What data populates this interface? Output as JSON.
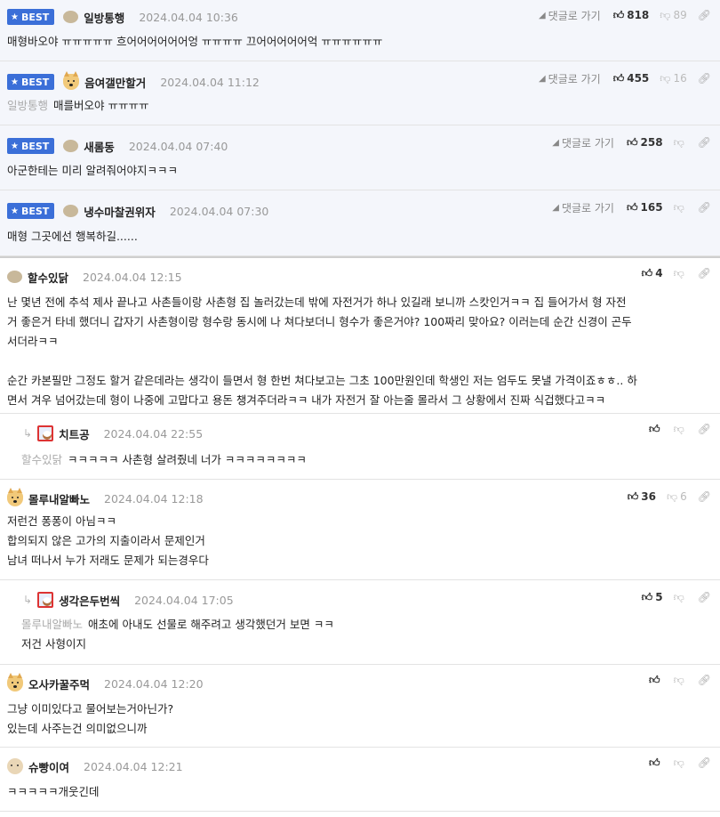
{
  "comments": [
    {
      "nick": "일방통행",
      "date": "2024.04.04 10:36",
      "best_label": "BEST",
      "goto_label": "댓글로 가기",
      "up": "818",
      "down": "89",
      "body": [
        "매형바오야 ㅠㅠㅠㅠㅠ 흐어어어어어어엉 ㅠㅠㅠㅠ 끄어어어어어억 ㅠㅠㅠㅠㅠㅠ"
      ]
    },
    {
      "nick": "음여갤만할거",
      "date": "2024.04.04 11:12",
      "best_label": "BEST",
      "goto_label": "댓글로 가기",
      "up": "455",
      "down": "16",
      "mention": "일방통행",
      "body": [
        "매를버오야 ㅠㅠㅠㅠ"
      ]
    },
    {
      "nick": "새롬동",
      "date": "2024.04.04 07:40",
      "best_label": "BEST",
      "goto_label": "댓글로 가기",
      "up": "258",
      "down": "",
      "body": [
        "아군한테는 미리 알려줘어야지ㅋㅋㅋ"
      ]
    },
    {
      "nick": "냉수마찰권위자",
      "date": "2024.04.04 07:30",
      "best_label": "BEST",
      "goto_label": "댓글로 가기",
      "up": "165",
      "down": "",
      "body": [
        "매형 그곳에선 행복하길......"
      ]
    },
    {
      "nick": "할수있닭",
      "date": "2024.04.04 12:15",
      "up": "4",
      "down": "",
      "body": [
        "난 몇년 전에 추석 제사 끝나고 사촌들이랑 사촌형 집 놀러갔는데 밖에 자전거가 하나 있길래 보니까 스캇인거ㅋㅋ 집 들어가서 형 자전",
        "거 좋은거 타네 했더니 갑자기 사촌형이랑 형수랑 동시에 나 쳐다보더니 형수가 좋은거야? 100짜리 맞아요? 이러는데 순간 신경이 곤두",
        "서더라ㅋㅋ",
        "",
        "순간 카본필만 그정도 할거 같은데라는 생각이 들면서 형 한번 쳐다보고는 그초 100만원인데 학생인 저는 엄두도 못낼 가격이죠ㅎㅎ.. 하",
        "면서 겨우 넘어갔는데 형이 나중에 고맙다고 용돈 챙겨주더라ㅋㅋ 내가 자전거 잘 아는줄 몰라서 그 상황에서 진짜 식겁했다고ㅋㅋ"
      ]
    },
    {
      "nick": "치트공",
      "date": "2024.04.04 22:55",
      "up": "",
      "down": "",
      "mention": "할수있닭",
      "body": [
        "ㅋㅋㅋㅋㅋ 사촌형 살려줬네 너가 ㅋㅋㅋㅋㅋㅋㅋㅋ"
      ]
    },
    {
      "nick": "몰루내알빠노",
      "date": "2024.04.04 12:18",
      "up": "36",
      "down": "6",
      "body": [
        "저런건 퐁퐁이 아님ㅋㅋ",
        "합의되지 않은 고가의 지출이라서 문제인거",
        "남녀 떠나서 누가 저래도 문제가 되는경우다"
      ]
    },
    {
      "nick": "생각은두번씩",
      "date": "2024.04.04 17:05",
      "up": "5",
      "down": "",
      "mention": "몰루내알빠노",
      "body": [
        "애초에 아내도 선물로 해주려고 생각했던거 보면 ㅋㅋ",
        "저건 사형이지"
      ]
    },
    {
      "nick": "오사카꿀주먹",
      "date": "2024.04.04 12:20",
      "up": "",
      "down": "",
      "body": [
        "그냥 이미있다고 물어보는거아닌가?",
        "있는데 사주는건 의미없으니까"
      ]
    },
    {
      "nick": "슈빵이여",
      "date": "2024.04.04 12:21",
      "up": "",
      "down": "",
      "body": [
        "ㅋㅋㅋㅋㅋ개웃긴데"
      ]
    }
  ]
}
